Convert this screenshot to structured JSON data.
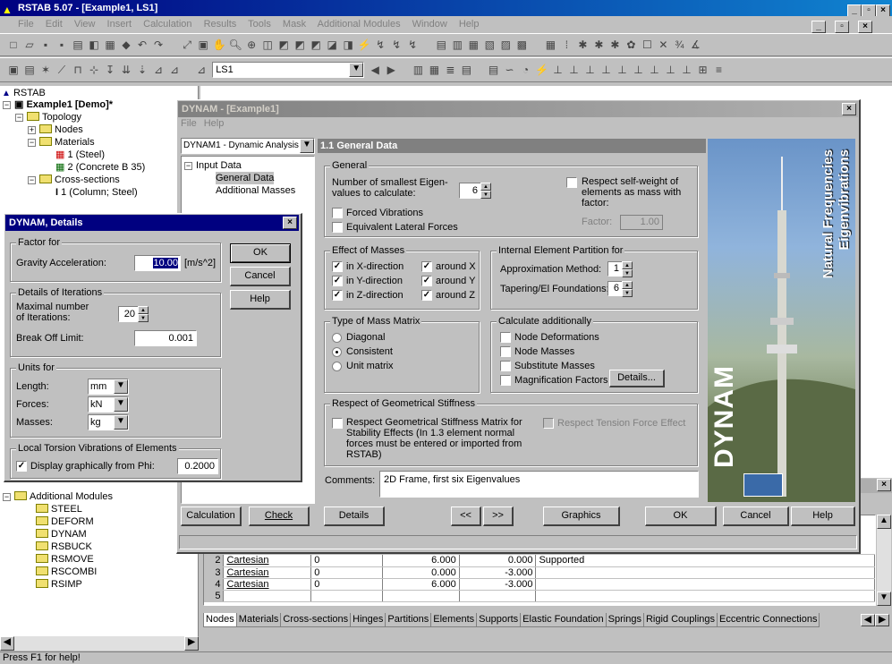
{
  "app": {
    "title": "RSTAB 5.07 - [Example1, LS1]",
    "menu": [
      "File",
      "Edit",
      "View",
      "Insert",
      "Calculation",
      "Results",
      "Tools",
      "Mask",
      "Additional Modules",
      "Window",
      "Help"
    ],
    "loadcase": "LS1",
    "status": "Press F1 for help!"
  },
  "tree": {
    "root": "RSTAB",
    "project": "Example1 [Demo]*",
    "items": [
      {
        "label": "Topology",
        "indent": 1
      },
      {
        "label": "Nodes",
        "indent": 2
      },
      {
        "label": "Materials",
        "indent": 2
      },
      {
        "label": "1 (Steel)",
        "indent": 3
      },
      {
        "label": "2 (Concrete B 35)",
        "indent": 3
      },
      {
        "label": "Cross-sections",
        "indent": 2
      },
      {
        "label": "1 (Column; Steel)",
        "indent": 3
      }
    ],
    "addl_label": "Additional Modules",
    "modules": [
      "STEEL",
      "DEFORM",
      "DYNAM",
      "RSBUCK",
      "RSMOVE",
      "RSCOMBI",
      "RSIMP"
    ]
  },
  "bottom_table": {
    "rows": [
      {
        "n": "2",
        "type": "Cartesian",
        "ref": "0",
        "x": "6.000",
        "z": "0.000",
        "support": "Supported"
      },
      {
        "n": "3",
        "type": "Cartesian",
        "ref": "0",
        "x": "0.000",
        "z": "-3.000",
        "support": ""
      },
      {
        "n": "4",
        "type": "Cartesian",
        "ref": "0",
        "x": "6.000",
        "z": "-3.000",
        "support": ""
      },
      {
        "n": "5",
        "type": "",
        "ref": "",
        "x": "",
        "z": "",
        "support": ""
      }
    ],
    "tabs": [
      "Nodes",
      "Materials",
      "Cross-sections",
      "Hinges",
      "Partitions",
      "Elements",
      "Supports",
      "Elastic Foundation",
      "Springs",
      "Rigid Couplings",
      "Eccentric Connections"
    ]
  },
  "dynam": {
    "title": "DYNAM - [Example1]",
    "menu": [
      "File",
      "Help"
    ],
    "case_select": "DYNAM1 - Dynamic Analysis",
    "nav_root": "Input Data",
    "nav": [
      "General Data",
      "Additional Masses"
    ],
    "section_title": "1.1 General Data",
    "general": {
      "label": "General",
      "eigen_label": "Number of smallest Eigen-values to calculate:",
      "eigen_value": "6",
      "forced": "Forced Vibrations",
      "equiv": "Equivalent Lateral Forces",
      "selfweight": "Respect self-weight of elements as mass with factor:",
      "factor_label": "Factor:",
      "factor_value": "1.00"
    },
    "masses": {
      "label": "Effect of Masses",
      "x": "in X-direction",
      "y": "in Y-direction",
      "z": "in Z-direction",
      "ax": "around X",
      "ay": "around Y",
      "az": "around Z"
    },
    "partition": {
      "label": "Internal Element Partition for",
      "approx": "Approximation Method:",
      "approx_value": "1",
      "taper": "Tapering/El Foundations:",
      "taper_value": "6"
    },
    "matrix": {
      "label": "Type of Mass Matrix",
      "opts": [
        "Diagonal",
        "Consistent",
        "Unit matrix"
      ]
    },
    "calc": {
      "label": "Calculate additionally",
      "opts": [
        "Node Deformations",
        "Node Masses",
        "Substitute Masses",
        "Magnification Factors"
      ],
      "details": "Details..."
    },
    "geo": {
      "label": "Respect of Geometrical Stiffness",
      "text": "Respect Geometrical Stiffness Matrix for Stability Effects (In 1.3 element normal forces must be entered or imported from RSTAB)",
      "tension": "Respect Tension Force Effect"
    },
    "comments_label": "Comments:",
    "comments": "2D Frame, first six Eigenvalues",
    "banner": {
      "line1": "Natural Frequencies",
      "line2": "Eigenvibrations",
      "brand": "DYNAM"
    },
    "buttons": {
      "calculation": "Calculation",
      "check": "Check",
      "details": "Details",
      "prev": "<<",
      "next": ">>",
      "graphics": "Graphics",
      "ok": "OK",
      "cancel": "Cancel",
      "help": "Help"
    }
  },
  "details": {
    "title": "DYNAM, Details",
    "factor_group": "Factor for",
    "gravity_label": "Gravity Acceleration:",
    "gravity_value": "10.00",
    "gravity_unit": "[m/s^2]",
    "iter_group": "Details of Iterations",
    "max_iter_label": "Maximal number of Iterations:",
    "max_iter_value": "20",
    "breakoff_label": "Break Off Limit:",
    "breakoff_value": "0.001",
    "units_group": "Units for",
    "length_label": "Length:",
    "length_value": "mm",
    "forces_label": "Forces:",
    "forces_value": "kN",
    "masses_label": "Masses:",
    "masses_value": "kg",
    "torsion_group": "Local Torsion Vibrations of Elements",
    "display_label": "Display graphically from Phi:",
    "phi_value": "0.2000",
    "ok": "OK",
    "cancel": "Cancel",
    "help": "Help"
  }
}
